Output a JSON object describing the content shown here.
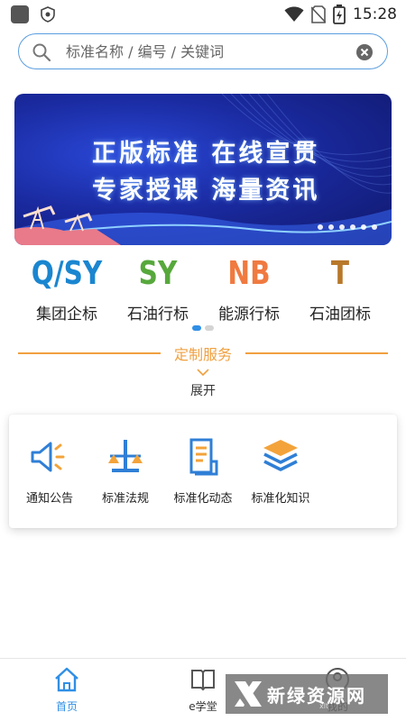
{
  "status_bar": {
    "time": "15:28"
  },
  "search": {
    "placeholder": "标准名称 / 编号 / 关键词"
  },
  "banner": {
    "line1": "正版标准  在线宣贯",
    "line2": "专家授课  海量资讯",
    "slide_count": 6
  },
  "categories": [
    {
      "logo": "Q/SY",
      "label": "集团企标",
      "color": "#1a86d0"
    },
    {
      "logo": "SY",
      "label": "石油行标",
      "color": "#57a83c"
    },
    {
      "logo": "NB",
      "label": "能源行标",
      "color": "#f07a40"
    },
    {
      "logo": "T",
      "label": "石油团标",
      "color": "#b8782a"
    }
  ],
  "category_page": {
    "current": 1,
    "total": 2,
    "active_color": "#2f8fe6",
    "inactive_color": "#d4d4d4"
  },
  "custom_service": {
    "title": "定制服务",
    "expand_label": "展开",
    "accent": "#f0a040"
  },
  "services": [
    {
      "label": "通知公告",
      "icon": "megaphone-icon"
    },
    {
      "label": "标准法规",
      "icon": "scale-icon"
    },
    {
      "label": "标准化动态",
      "icon": "document-icon"
    },
    {
      "label": "标准化知识",
      "icon": "layers-icon"
    }
  ],
  "bottom_nav": {
    "items": [
      {
        "label": "首页",
        "icon": "home-icon",
        "active": true
      },
      {
        "label": "e学堂",
        "icon": "book-icon",
        "active": false
      },
      {
        "label": "我的",
        "icon": "profile-icon",
        "active": false
      }
    ],
    "active_color": "#2f8fe6"
  },
  "watermark": {
    "text": "新绿资源网",
    "sub": "xlt"
  }
}
